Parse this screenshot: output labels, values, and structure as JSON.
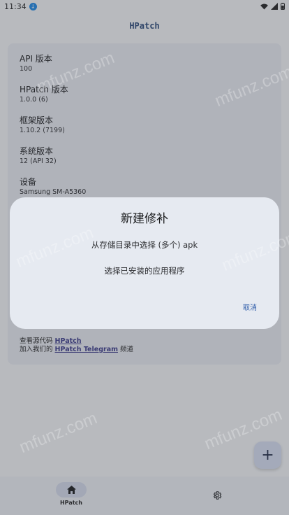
{
  "status_bar": {
    "time": "11:34"
  },
  "app": {
    "title": "HPatch"
  },
  "info": [
    {
      "label": "API 版本",
      "value": "100"
    },
    {
      "label": "HPatch 版本",
      "value": "1.0.0 (6)"
    },
    {
      "label": "框架版本",
      "value": "1.10.2 (7199)"
    },
    {
      "label": "系统版本",
      "value": "12 (API 32)"
    },
    {
      "label": "设备",
      "value": "Samsung SM-A5360"
    }
  ],
  "links": {
    "source_prefix": "查看源代码 ",
    "source_link": "HPatch",
    "telegram_prefix": "加入我们的 ",
    "telegram_link": "HPatch Telegram",
    "telegram_suffix": " 频道"
  },
  "fab": {
    "label": "+"
  },
  "bottom_nav": {
    "home_label": "HPatch"
  },
  "dialog": {
    "title": "新建修补",
    "option_storage": "从存储目录中选择 (多个) apk",
    "option_installed": "选择已安装的应用程序",
    "cancel": "取消"
  },
  "watermark": {
    "text": "mfunz.com"
  },
  "colors": {
    "accent": "#2b5aa8",
    "card": "#e8ebf1",
    "dialog": "#e6eaf1"
  }
}
